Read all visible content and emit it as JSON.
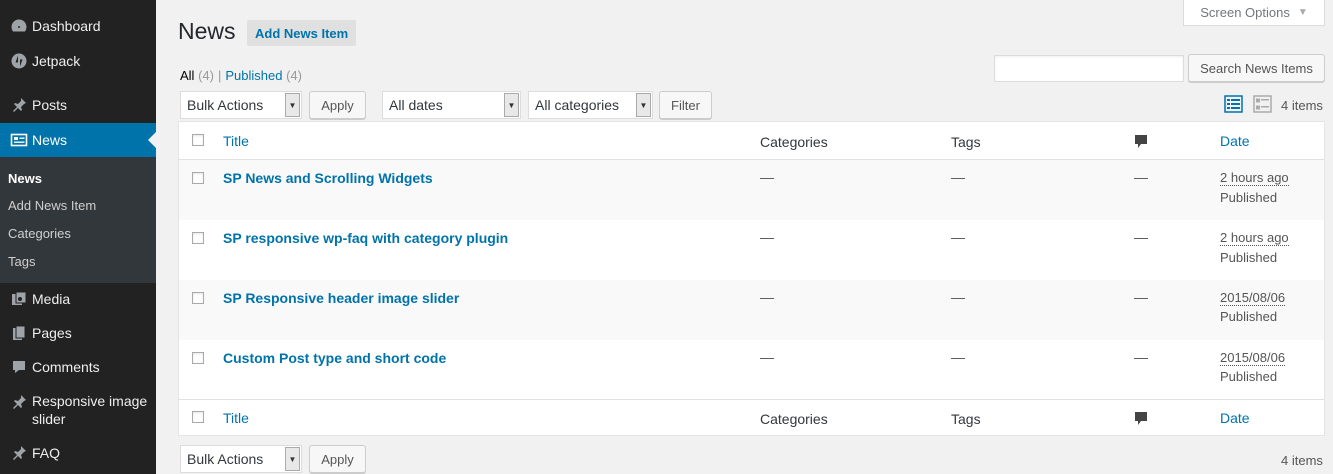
{
  "sidebar": {
    "items": [
      {
        "label": "Dashboard",
        "icon": "dashboard-icon"
      },
      {
        "label": "Jetpack",
        "icon": "jetpack-icon"
      },
      {
        "label": "Posts",
        "icon": "pin-icon"
      },
      {
        "label": "News",
        "icon": "news-icon"
      },
      {
        "label": "Media",
        "icon": "media-icon"
      },
      {
        "label": "Pages",
        "icon": "pages-icon"
      },
      {
        "label": "Comments",
        "icon": "comments-icon"
      },
      {
        "label": "Responsive image slider",
        "icon": "pin-icon"
      },
      {
        "label": "FAQ",
        "icon": "pin-icon"
      }
    ],
    "submenu": [
      "News",
      "Add News Item",
      "Categories",
      "Tags"
    ]
  },
  "header": {
    "title": "News",
    "add_new_label": "Add News Item",
    "screen_options_label": "Screen Options"
  },
  "filters": {
    "all_label": "All",
    "all_count": "(4)",
    "separator": "|",
    "published_label": "Published",
    "published_count": "(4)"
  },
  "search": {
    "value": "",
    "button_label": "Search News Items"
  },
  "tablenav_top": {
    "bulk_actions": "Bulk Actions",
    "apply_label": "Apply",
    "dates": "All dates",
    "categories": "All categories",
    "filter_label": "Filter",
    "items_count": "4 items"
  },
  "tablenav_bottom": {
    "bulk_actions": "Bulk Actions",
    "apply_label": "Apply",
    "items_count": "4 items"
  },
  "table": {
    "columns": {
      "title": "Title",
      "categories": "Categories",
      "tags": "Tags",
      "date": "Date"
    },
    "rows": [
      {
        "title": "SP News and Scrolling Widgets",
        "categories": "—",
        "tags": "—",
        "comments": "—",
        "date": "2 hours ago",
        "status": "Published"
      },
      {
        "title": "SP responsive wp-faq with category plugin",
        "categories": "—",
        "tags": "—",
        "comments": "—",
        "date": "2 hours ago",
        "status": "Published"
      },
      {
        "title": "SP Responsive header image slider",
        "categories": "—",
        "tags": "—",
        "comments": "—",
        "date": "2015/08/06",
        "status": "Published"
      },
      {
        "title": "Custom Post type and short code",
        "categories": "—",
        "tags": "—",
        "comments": "—",
        "date": "2015/08/06",
        "status": "Published"
      }
    ]
  },
  "colors": {
    "accent": "#0073aa",
    "sidebar_bg": "#222222",
    "submenu_bg": "#32373c"
  }
}
